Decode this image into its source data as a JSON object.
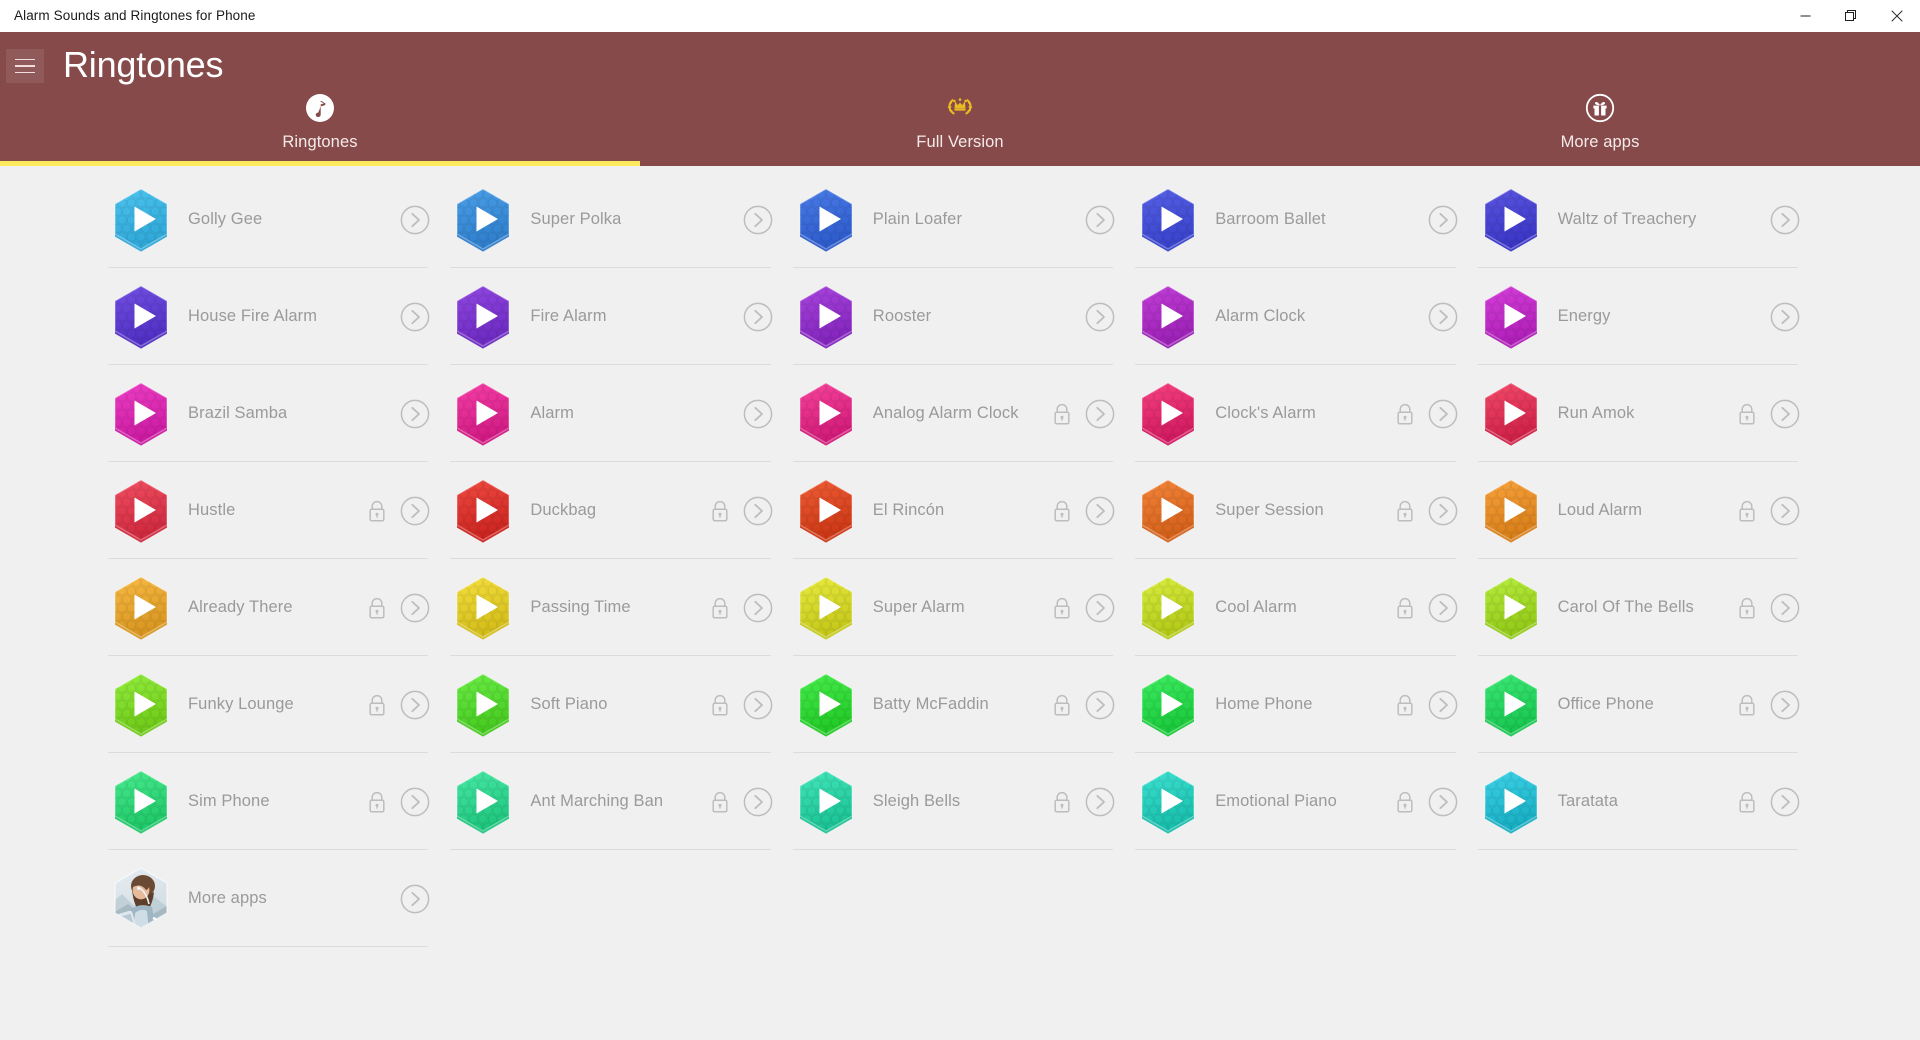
{
  "window": {
    "title": "Alarm Sounds and Ringtones for Phone",
    "controls": [
      {
        "name": "minimize-button",
        "glyph": "minimize"
      },
      {
        "name": "restore-button",
        "glyph": "restore"
      },
      {
        "name": "close-button",
        "glyph": "close"
      }
    ]
  },
  "header": {
    "title": "Ringtones",
    "menu_icon": "hamburger-icon",
    "background_color": "#864a4a",
    "accent_color": "#ffe95c"
  },
  "tabs": [
    {
      "label": "Ringtones",
      "icon": "music-note-icon",
      "active": true
    },
    {
      "label": "Full Version",
      "icon": "crown-laurel-icon",
      "active": false
    },
    {
      "label": "More apps",
      "icon": "gift-circle-icon",
      "active": false
    }
  ],
  "list": {
    "columns": 5,
    "items": [
      {
        "label": "Golly Gee",
        "color": "#4cc3ef",
        "dark": "#2fa8d8",
        "locked": false,
        "type": "hex"
      },
      {
        "label": "Super Polka",
        "color": "#4b9fe8",
        "dark": "#2f7fcc",
        "locked": false,
        "type": "hex"
      },
      {
        "label": "Plain Loafer",
        "color": "#4a7ce8",
        "dark": "#2d5ccc",
        "locked": false,
        "type": "hex"
      },
      {
        "label": "Barroom Ballet",
        "color": "#5661e6",
        "dark": "#3a43cc",
        "locked": false,
        "type": "hex"
      },
      {
        "label": "Waltz of Treachery",
        "color": "#5b56e0",
        "dark": "#3b36c6",
        "locked": false,
        "type": "hex"
      },
      {
        "label": "House Fire Alarm",
        "color": "#7350e4",
        "dark": "#5030c4",
        "locked": false,
        "type": "hex"
      },
      {
        "label": "Fire Alarm",
        "color": "#9148e2",
        "dark": "#6d2bc2",
        "locked": false,
        "type": "hex"
      },
      {
        "label": "Rooster",
        "color": "#a845de",
        "dark": "#8425be",
        "locked": false,
        "type": "hex"
      },
      {
        "label": "Alarm Clock",
        "color": "#c23fd8",
        "dark": "#9c21b6",
        "locked": false,
        "type": "hex"
      },
      {
        "label": "Energy",
        "color": "#d63fdb",
        "dark": "#b01fb8",
        "locked": false,
        "type": "hex"
      },
      {
        "label": "Brazil Samba",
        "color": "#ef3fc6",
        "dark": "#cc1ba2",
        "locked": false,
        "type": "hex"
      },
      {
        "label": "Alarm",
        "color": "#f73fa8",
        "dark": "#d21a84",
        "locked": false,
        "type": "hex"
      },
      {
        "label": "Analog Alarm Clock",
        "color": "#f8449c",
        "dark": "#d21a78",
        "locked": true,
        "type": "hex"
      },
      {
        "label": "Clock's Alarm",
        "color": "#f84281",
        "dark": "#d21a60",
        "locked": true,
        "type": "hex"
      },
      {
        "label": "Run Amok",
        "color": "#f44b6b",
        "dark": "#d02148",
        "locked": true,
        "type": "hex"
      },
      {
        "label": "Hustle",
        "color": "#f24f62",
        "dark": "#d0293e",
        "locked": true,
        "type": "hex"
      },
      {
        "label": "Duckbag",
        "color": "#ef4a42",
        "dark": "#cd2520",
        "locked": true,
        "type": "hex"
      },
      {
        "label": "El Rincón",
        "color": "#ef5d36",
        "dark": "#cd3815",
        "locked": true,
        "type": "hex"
      },
      {
        "label": "Super Session",
        "color": "#f5853b",
        "dark": "#d4611a",
        "locked": true,
        "type": "hex"
      },
      {
        "label": "Loud Alarm",
        "color": "#f9a33c",
        "dark": "#d87f19",
        "locked": true,
        "type": "hex"
      },
      {
        "label": "Already There",
        "color": "#f9bb45",
        "dark": "#d8961f",
        "locked": true,
        "type": "hex"
      },
      {
        "label": "Passing Time",
        "color": "#f5e03f",
        "dark": "#d4bd19",
        "locked": true,
        "type": "hex"
      },
      {
        "label": "Super Alarm",
        "color": "#e9ec3f",
        "dark": "#c5c819",
        "locked": true,
        "type": "hex"
      },
      {
        "label": "Cool Alarm",
        "color": "#d9ee3f",
        "dark": "#b4ca19",
        "locked": true,
        "type": "hex"
      },
      {
        "label": "Carol Of The Bells",
        "color": "#b8ee3e",
        "dark": "#93ca18",
        "locked": true,
        "type": "hex"
      },
      {
        "label": "Funky Lounge",
        "color": "#93ee3e",
        "dark": "#6fca18",
        "locked": true,
        "type": "hex"
      },
      {
        "label": "Soft Piano",
        "color": "#6bee47",
        "dark": "#47ca20",
        "locked": true,
        "type": "hex"
      },
      {
        "label": "Batty McFaddin",
        "color": "#47ee4d",
        "dark": "#22ca26",
        "locked": true,
        "type": "hex"
      },
      {
        "label": "Home Phone",
        "color": "#3fee62",
        "dark": "#19ca3b",
        "locked": true,
        "type": "hex"
      },
      {
        "label": "Office Phone",
        "color": "#3eea77",
        "dark": "#18c650",
        "locked": true,
        "type": "hex"
      },
      {
        "label": "Sim Phone",
        "color": "#48ec8e",
        "dark": "#1fc868",
        "locked": true,
        "type": "hex"
      },
      {
        "label": "Ant Marching Ban",
        "color": "#48eaa6",
        "dark": "#1fc67e",
        "locked": true,
        "type": "hex"
      },
      {
        "label": "Sleigh Bells",
        "color": "#43e7bb",
        "dark": "#1bc395",
        "locked": true,
        "type": "hex"
      },
      {
        "label": "Emotional Piano",
        "color": "#3ee2d2",
        "dark": "#18beac",
        "locked": true,
        "type": "hex"
      },
      {
        "label": "Taratata",
        "color": "#3ed3e8",
        "dark": "#18afc4",
        "locked": true,
        "type": "hex"
      },
      {
        "label": "More apps",
        "color": "#cfd8dd",
        "dark": "#a9b4ba",
        "locked": false,
        "type": "photo"
      }
    ]
  },
  "icons": {
    "lock": "lock-icon",
    "chevron": "chevron-right-circle-icon",
    "play": "play-icon"
  }
}
